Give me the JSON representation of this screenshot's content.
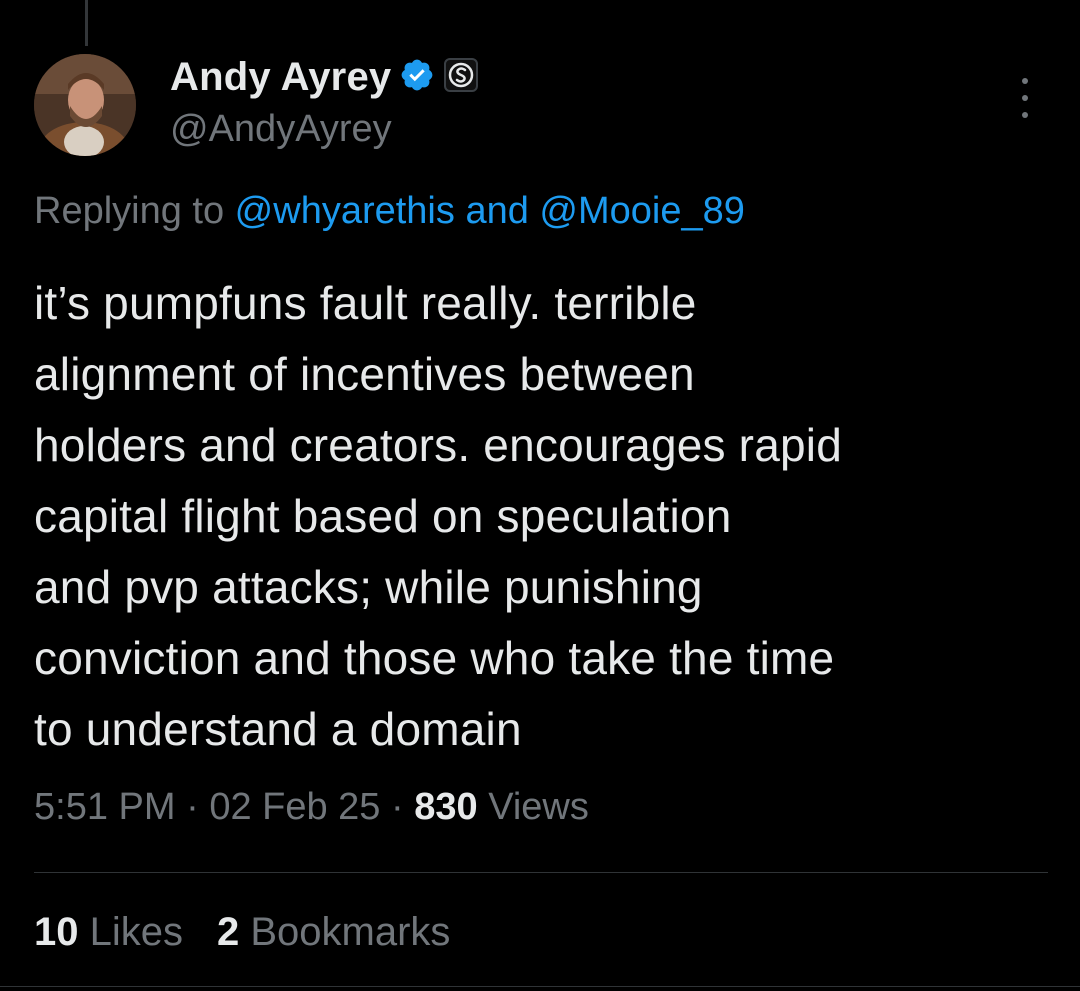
{
  "author": {
    "display_name": "Andy Ayrey",
    "handle": "@AndyAyrey",
    "avatar_icon": "profile-photo",
    "verified_icon": "verified-badge-icon",
    "affiliate_icon": "affiliate-badge-icon"
  },
  "reply": {
    "prefix": "Replying to ",
    "mention_1": "@whyarethis",
    "joiner": " and ",
    "mention_2": "@Mooie_89"
  },
  "tweet": {
    "text": "it’s pumpfuns fault really. terrible\nalignment of incentives between\nholders and creators. encourages rapid\ncapital flight based on speculation\nand pvp attacks; while punishing\nconviction and those who take the time\nto understand a domain"
  },
  "meta": {
    "time": "5:51 PM",
    "sep_1": " · ",
    "date": "02 Feb 25",
    "sep_2": " · ",
    "views_count": "830",
    "views_label": " Views"
  },
  "stats": {
    "likes_count": "10",
    "likes_label": " Likes",
    "bookmarks_count": "2",
    "bookmarks_label": " Bookmarks"
  },
  "colors": {
    "background": "#000000",
    "text_primary": "#e7e9ea",
    "text_secondary": "#71767b",
    "link": "#1d9bf0",
    "verified": "#1d9bf0"
  }
}
